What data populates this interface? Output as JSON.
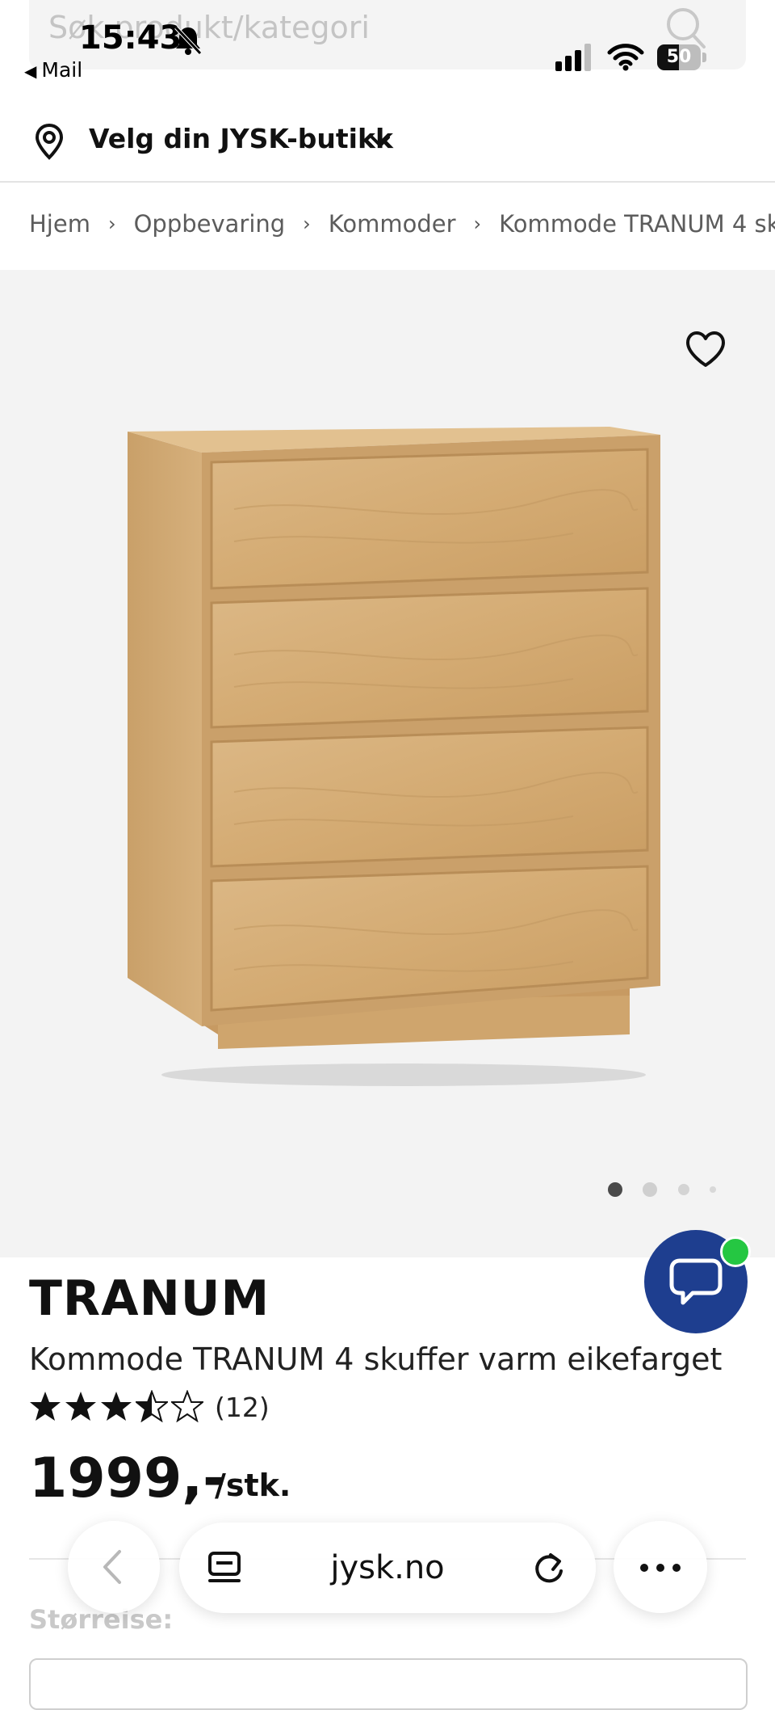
{
  "search": {
    "placeholder": "Søk produkt/kategori"
  },
  "status_bar": {
    "time": "15:43",
    "back_app": "Mail",
    "battery": {
      "label": "50",
      "level_percent": 50
    }
  },
  "store": {
    "label": "Velg din JYSK-butikk"
  },
  "breadcrumb": [
    "Hjem",
    "Oppbevaring",
    "Kommoder",
    "Kommode TRANUM 4 sk"
  ],
  "gallery": {
    "image_count": 4,
    "active_index": 0
  },
  "product": {
    "brand": "TRANUM",
    "title": "Kommode TRANUM 4 skuffer varm eikefarget",
    "rating": {
      "value": 3.5,
      "max": 5,
      "count_label": "(12)"
    },
    "price": "1999,-",
    "price_unit": "/stk.",
    "size_label": "Størreise:"
  },
  "browser": {
    "url": "jysk.no"
  },
  "colors": {
    "chat_blue": "#1e3e8f",
    "badge_green": "#25c742",
    "wood": "#d9b27d"
  }
}
